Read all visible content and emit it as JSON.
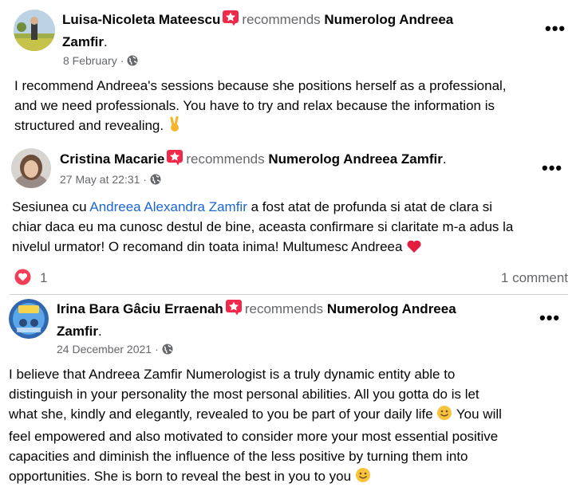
{
  "posts": [
    {
      "author": "Luisa-Nicoleta Mateescu",
      "verb": "recommends",
      "page_l1": "Numerolog Andreea",
      "page_l2": "Zamfir",
      "date": "8 February",
      "dot": "·",
      "text_lines": [
        "I recommend Andreea's sessions because she positions herself as a professional,",
        "and we need professionals. You have to try and relax because the information is",
        "structured and revealing."
      ]
    },
    {
      "author": "Cristina Macarie",
      "verb": "recommends",
      "page": "Numerolog Andreea Zamfir",
      "date": "27 May at 22:31",
      "dot": "·",
      "line1_pre": "Sesiunea cu ",
      "mention": "Andreea Alexandra Zamfir",
      "line1_post": " a fost atat de profunda si atat de clara si",
      "line2": "chiar daca eu ma cunosc destul de bine, aceasta confirmare si claritate m-a adus la",
      "line3": "nivelul urmator! O recomand din toata inima! Multumesc Andreea",
      "reaction_count": "1",
      "comments": "1 comment"
    },
    {
      "author": "Irina Bara Gâciu Erraenah",
      "verb": "recommends",
      "page_l1": "Numerolog Andreea",
      "page_l2": "Zamfir",
      "date": "24 December 2021",
      "dot": "·",
      "text_lines": [
        "I believe that Andreea Zamfir Numerologist is a truly dynamic entity able to",
        "distinguish in your personality the most personal abilities. All you gotta do is let",
        "what she, kindly and elegantly, revealed to you be part of your daily life",
        "feel empowered and also motivated to consider more your most essential positive",
        "capacities and diminish the influence of the less positive by turning them into",
        "opportunities. She is born to reveal the best in you to you"
      ],
      "line3_tail": "You will"
    }
  ],
  "period": ".",
  "more": "•••",
  "colors": {
    "text": "#050505",
    "muted": "#65676b",
    "link": "#1b66d2",
    "star": "#f02849"
  }
}
